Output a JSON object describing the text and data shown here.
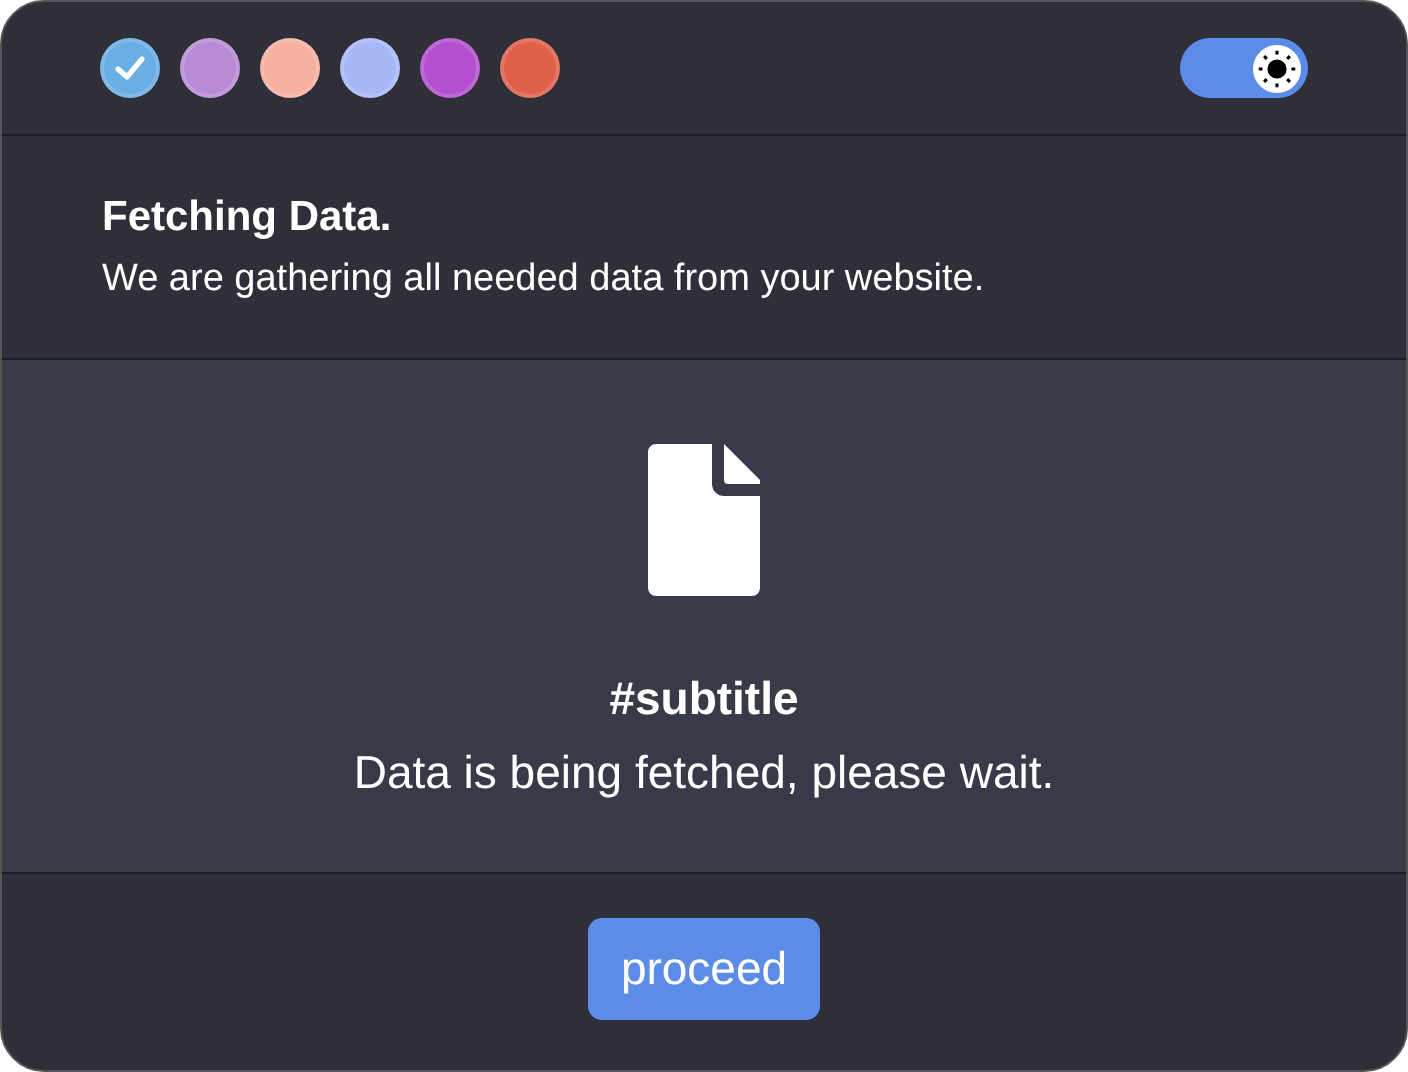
{
  "swatches": [
    {
      "color": "#6aaee6",
      "selected": true
    },
    {
      "color": "#b98bd6",
      "selected": false
    },
    {
      "color": "#f6b0a0",
      "selected": false
    },
    {
      "color": "#a8b8f6",
      "selected": false
    },
    {
      "color": "#b44fd0",
      "selected": false
    },
    {
      "color": "#e0604a",
      "selected": false
    }
  ],
  "theme_toggle": {
    "on": true
  },
  "header": {
    "title": "Fetching Data.",
    "description": "We are gathering all needed data from your website."
  },
  "content": {
    "subtitle": "#subtitle",
    "message": "Data is being fetched, please wait."
  },
  "buttons": [
    "proceed"
  ]
}
